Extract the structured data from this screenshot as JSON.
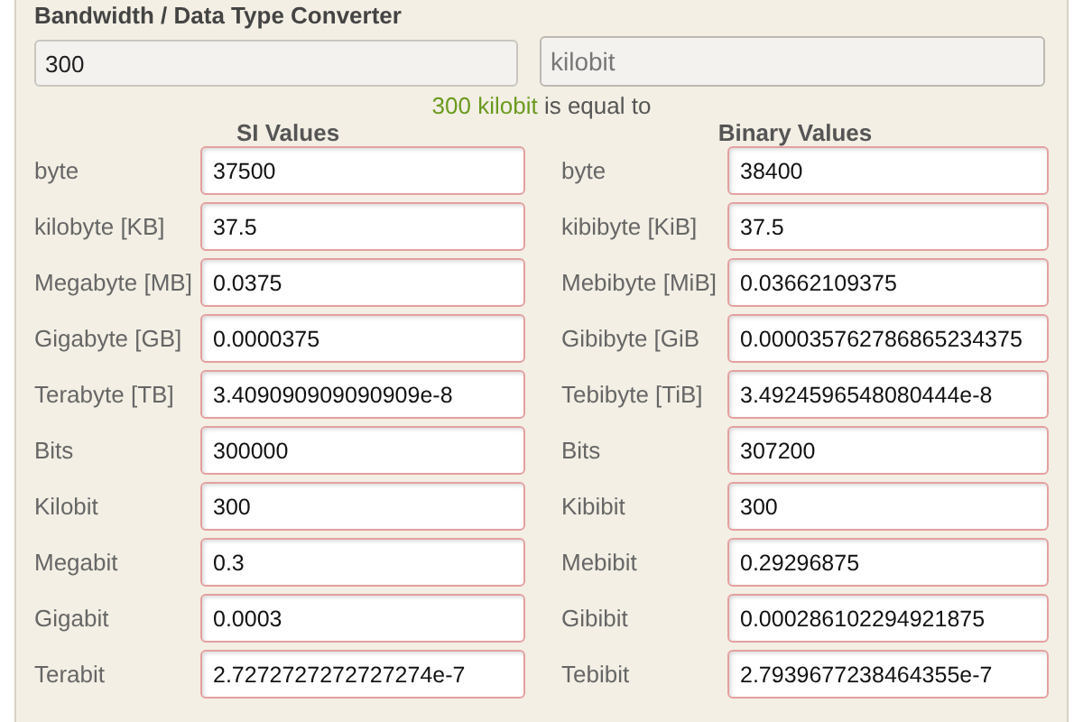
{
  "title": "Bandwidth / Data Type Converter",
  "amount": {
    "value": "300"
  },
  "unit": {
    "value": "kilobit"
  },
  "result": {
    "quantity": "300 kilobit",
    "text": "is equal to"
  },
  "si": {
    "heading": "SI Values",
    "rows": [
      {
        "label": "byte",
        "value": "37500"
      },
      {
        "label": "kilobyte [KB]",
        "value": "37.5"
      },
      {
        "label": "Megabyte [MB]",
        "value": "0.0375"
      },
      {
        "label": "Gigabyte [GB]",
        "value": "0.0000375"
      },
      {
        "label": "Terabyte [TB]",
        "value": "3.409090909090909e-8"
      },
      {
        "label": "Bits",
        "value": "300000"
      },
      {
        "label": "Kilobit",
        "value": "300"
      },
      {
        "label": "Megabit",
        "value": "0.3"
      },
      {
        "label": "Gigabit",
        "value": "0.0003"
      },
      {
        "label": "Terabit",
        "value": "2.7272727272727274e-7"
      }
    ]
  },
  "binary": {
    "heading": "Binary Values",
    "rows": [
      {
        "label": "byte",
        "value": "38400"
      },
      {
        "label": "kibibyte [KiB]",
        "value": "37.5"
      },
      {
        "label": "Mebibyte [MiB]",
        "value": "0.03662109375"
      },
      {
        "label": "Gibibyte [GiB",
        "value": "0.000035762786865234375"
      },
      {
        "label": "Tebibyte [TiB]",
        "value": "3.4924596548080444e-8"
      },
      {
        "label": "Bits",
        "value": "307200"
      },
      {
        "label": "Kibibit",
        "value": "300"
      },
      {
        "label": "Mebibit",
        "value": "0.29296875"
      },
      {
        "label": "Gibibit",
        "value": "0.000286102294921875"
      },
      {
        "label": "Tebibit",
        "value": "2.7939677238464355e-7"
      }
    ]
  }
}
